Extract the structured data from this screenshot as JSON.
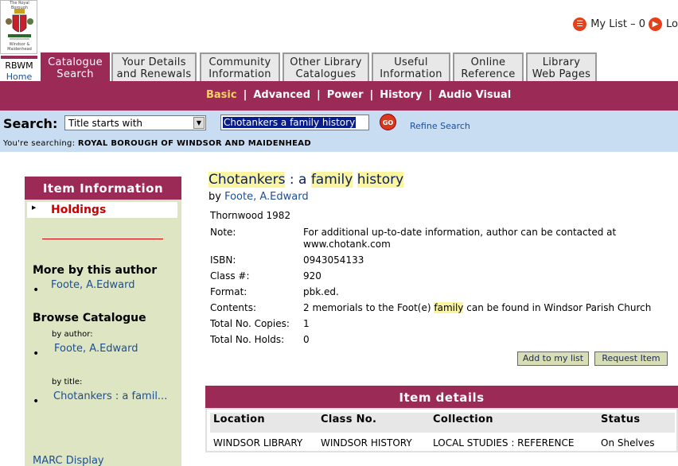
{
  "logo": {
    "top_text": "The Royal Borough",
    "bottom_text": "Windsor & Maidenhead"
  },
  "mylist": {
    "label": "My List – 0",
    "logout": "Lo"
  },
  "home_tab": {
    "line1": "RBWM",
    "line2": "Home"
  },
  "tabs": [
    {
      "line1": "Catalogue",
      "line2": "Search",
      "active": true
    },
    {
      "line1": "Your Details",
      "line2": "and Renewals"
    },
    {
      "line1": "Community",
      "line2": "Information"
    },
    {
      "line1": "Other Library",
      "line2": "Catalogues"
    },
    {
      "line1": "Useful",
      "line2": "Information"
    },
    {
      "line1": "Online",
      "line2": "Reference"
    },
    {
      "line1": "Library",
      "line2": "Web Pages"
    }
  ],
  "subnav": [
    "Basic",
    "Advanced",
    "Power",
    "History",
    "Audio Visual"
  ],
  "search": {
    "label": "Search:",
    "type_selected": "Title starts with",
    "query": "Chotankers a family history",
    "go": "GO",
    "refine": "Refine Search",
    "searching_prefix": "You're searching:",
    "searching_scope": "ROYAL BOROUGH OF WINDSOR AND MAIDENHEAD"
  },
  "left": {
    "header": "Item Information",
    "holdings": "Holdings",
    "more_by_author": "More by this author",
    "author_link": "Foote, A.Edward",
    "browse": "Browse Catalogue",
    "by_author_label": "by author:",
    "by_author_link": "Foote, A.Edward",
    "by_title_label": "by title:",
    "by_title_link": "Chotankers : a famil...",
    "marc": "MARC Display"
  },
  "item": {
    "title_w1": "Chotankers",
    "title_sep": " : a ",
    "title_w2": "family",
    "title_w3": "history",
    "by": "by ",
    "author": "Foote, A.Edward",
    "publisher": "Thornwood 1982",
    "note_label": "Note:",
    "note_line1": "For additional up-to-date information, author can be contacted at",
    "note_line2": "www.chotank.com",
    "isbn_label": "ISBN:",
    "isbn": "0943054133",
    "class_label": "Class #:",
    "class": "920",
    "format_label": "Format:",
    "format": "pbk.ed.",
    "contents_label": "Contents:",
    "contents_pre": "2 memorials to the Foot(e) ",
    "contents_hl": "family",
    "contents_post": " can be found in Windsor Parish Church",
    "copies_label": "Total No. Copies:",
    "copies": "1",
    "holds_label": "Total No. Holds:",
    "holds": "0",
    "add_btn": "Add to my list",
    "request_btn": "Request Item"
  },
  "details": {
    "header": "Item details",
    "columns": [
      "Location",
      "Class No.",
      "Collection",
      "Status"
    ],
    "rows": [
      [
        "WINDSOR LIBRARY",
        "WINDSOR HISTORY",
        "LOCAL STUDIES : REFERENCE",
        "On Shelves"
      ]
    ]
  },
  "colors": {
    "brand": "#9b2a57",
    "search_bg": "#c9ddf2",
    "left_bg": "#dde5c2",
    "highlight": "#fbf5a0",
    "link": "#1d4f96"
  }
}
